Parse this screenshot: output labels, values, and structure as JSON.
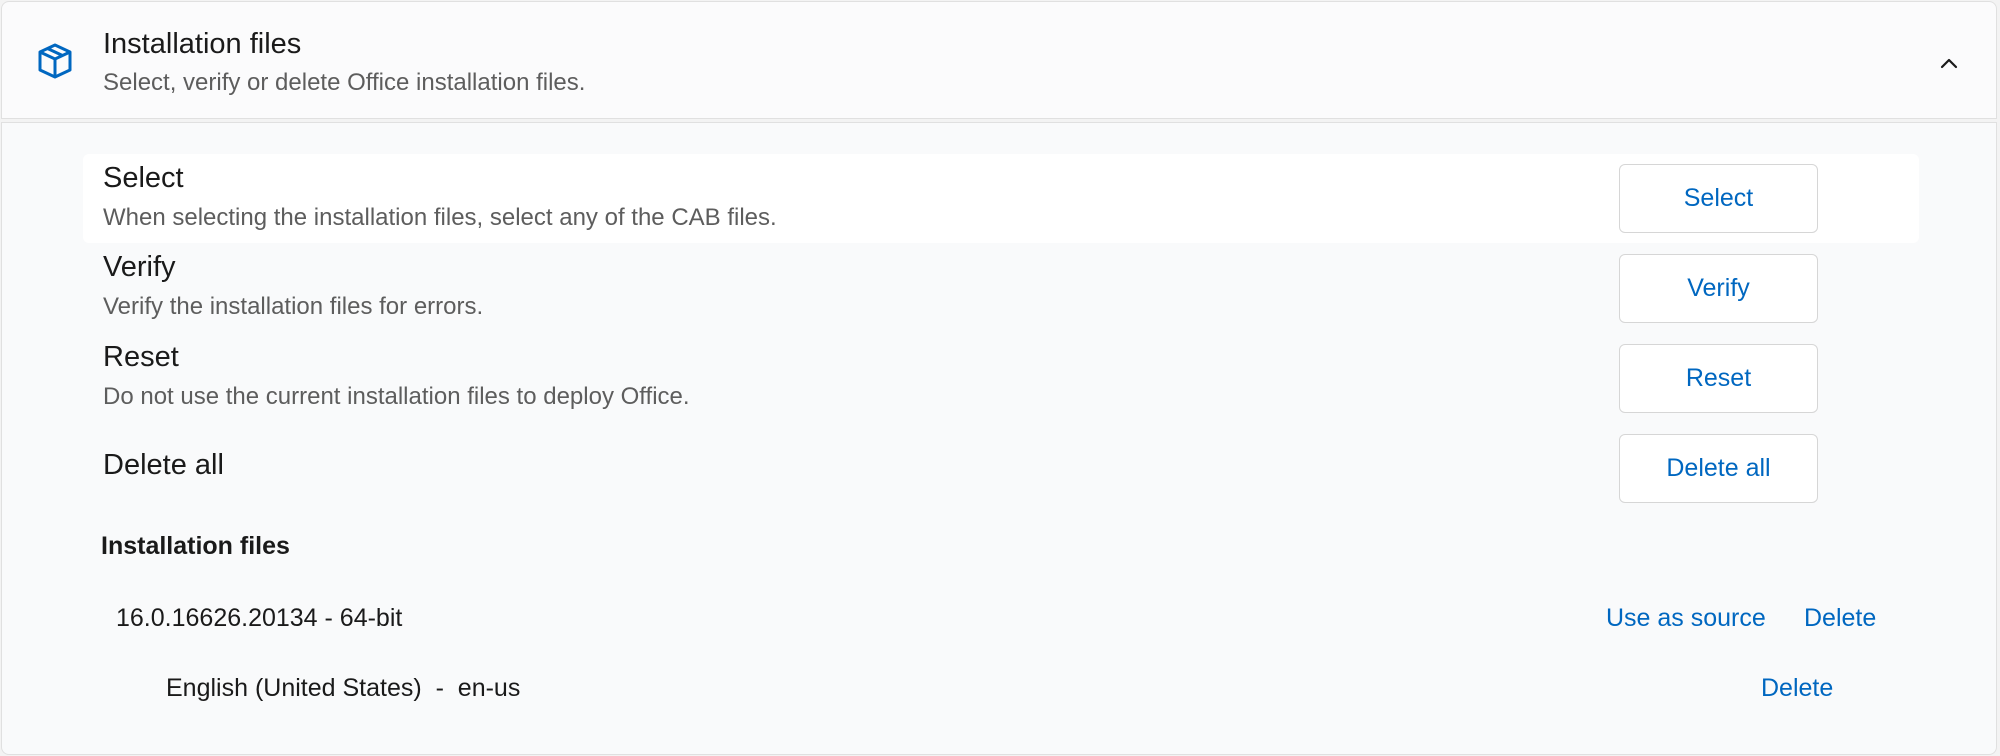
{
  "header": {
    "title": "Installation files",
    "subtitle": "Select, verify or delete Office installation files.",
    "icon": "package-box-icon",
    "collapse_icon": "chevron-up-icon"
  },
  "rows": [
    {
      "title": "Select",
      "description": "When selecting the installation files, select any of the CAB files.",
      "button": "Select"
    },
    {
      "title": "Verify",
      "description": "Verify the installation files for errors.",
      "button": "Verify"
    },
    {
      "title": "Reset",
      "description": "Do not use the current installation files to deploy Office.",
      "button": "Reset"
    },
    {
      "title": "Delete all",
      "button": "Delete all"
    }
  ],
  "files": {
    "heading": "Installation files",
    "version": {
      "name": "16.0.16626.20134 - 64-bit",
      "use_as_source": "Use as source",
      "delete": "Delete"
    },
    "language": {
      "name": "English (United States)  -  en-us",
      "delete": "Delete"
    }
  },
  "colors": {
    "accent": "#0067c0",
    "text": "#1a1a1a",
    "secondary_text": "#5d5d5d"
  }
}
